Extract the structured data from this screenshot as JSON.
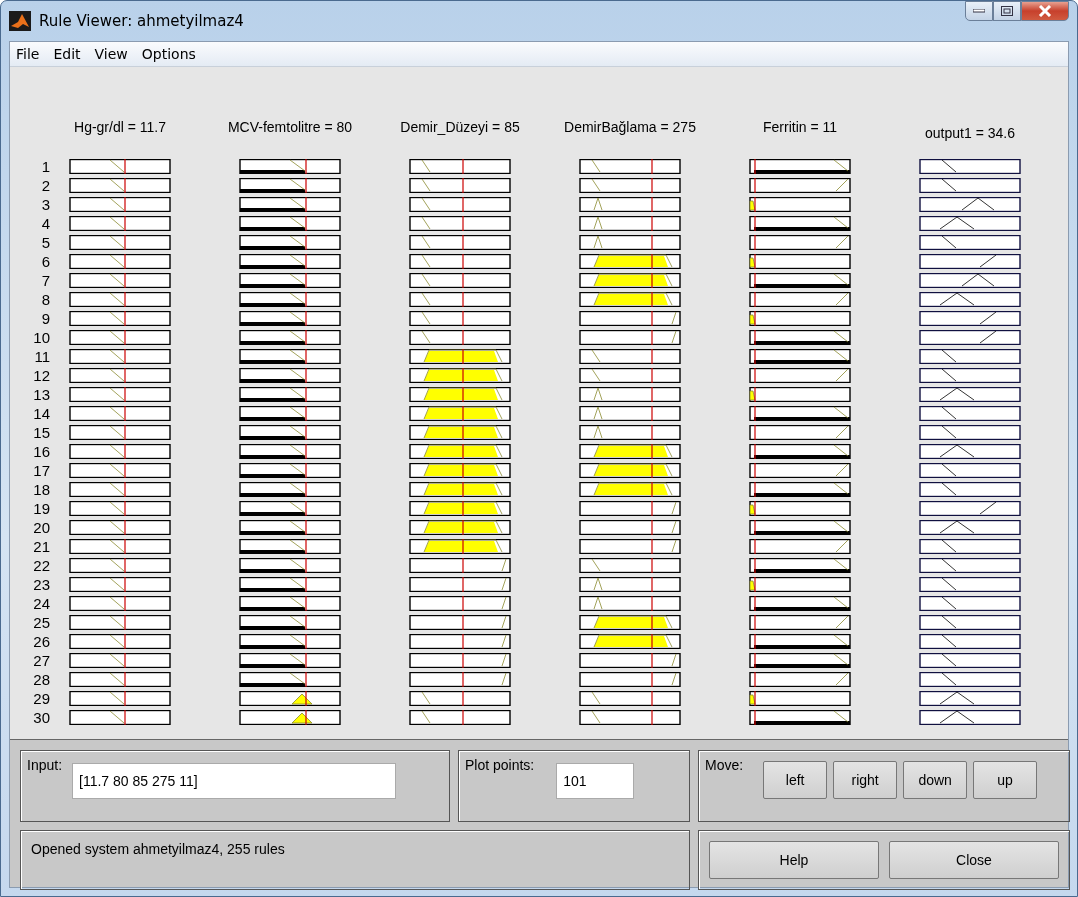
{
  "window": {
    "title": "Rule Viewer: ahmetyilmaz4"
  },
  "menu": [
    "File",
    "Edit",
    "View",
    "Options"
  ],
  "columns": [
    {
      "label": "Hg-gr/dl = 11.7"
    },
    {
      "label": "MCV-femtolitre = 80"
    },
    {
      "label": "Demir_Düzeyi = 85"
    },
    {
      "label": "DemirBağlama = 275"
    },
    {
      "label": "Ferritin = 11"
    },
    {
      "label": "output1 = 34.6"
    }
  ],
  "rules": [
    {
      "number": "1",
      "cells": [
        {
          "kind": "z-center"
        },
        {
          "kind": "z-right-fired"
        },
        {
          "kind": "z-left"
        },
        {
          "kind": "z-left"
        },
        {
          "kind": "z-far-fired"
        },
        {
          "kind": "out-low"
        }
      ]
    },
    {
      "number": "2",
      "cells": [
        {
          "kind": "z-center"
        },
        {
          "kind": "z-right-fired"
        },
        {
          "kind": "z-left"
        },
        {
          "kind": "z-left"
        },
        {
          "kind": "s-far"
        },
        {
          "kind": "out-low"
        }
      ]
    },
    {
      "number": "3",
      "cells": [
        {
          "kind": "z-center"
        },
        {
          "kind": "z-right-fired"
        },
        {
          "kind": "z-left"
        },
        {
          "kind": "tri-left"
        },
        {
          "kind": "left-fired"
        },
        {
          "kind": "out-tri-mid"
        }
      ]
    },
    {
      "number": "4",
      "cells": [
        {
          "kind": "z-center"
        },
        {
          "kind": "z-right-fired"
        },
        {
          "kind": "z-left"
        },
        {
          "kind": "tri-left"
        },
        {
          "kind": "z-far-fired"
        },
        {
          "kind": "out-tri-left"
        }
      ]
    },
    {
      "number": "5",
      "cells": [
        {
          "kind": "z-center"
        },
        {
          "kind": "z-right-fired"
        },
        {
          "kind": "z-left"
        },
        {
          "kind": "tri-left"
        },
        {
          "kind": "s-far"
        },
        {
          "kind": "out-low"
        }
      ]
    },
    {
      "number": "6",
      "cells": [
        {
          "kind": "z-center"
        },
        {
          "kind": "z-right-fired"
        },
        {
          "kind": "z-left"
        },
        {
          "kind": "trap-fired"
        },
        {
          "kind": "left-fired"
        },
        {
          "kind": "out-high"
        }
      ]
    },
    {
      "number": "7",
      "cells": [
        {
          "kind": "z-center"
        },
        {
          "kind": "z-right-fired"
        },
        {
          "kind": "z-left"
        },
        {
          "kind": "trap-fired"
        },
        {
          "kind": "z-far-fired"
        },
        {
          "kind": "out-tri-mid"
        }
      ]
    },
    {
      "number": "8",
      "cells": [
        {
          "kind": "z-center"
        },
        {
          "kind": "z-right-fired"
        },
        {
          "kind": "z-left"
        },
        {
          "kind": "trap-fired"
        },
        {
          "kind": "s-far"
        },
        {
          "kind": "out-tri-left"
        }
      ]
    },
    {
      "number": "9",
      "cells": [
        {
          "kind": "z-center"
        },
        {
          "kind": "z-right-fired"
        },
        {
          "kind": "z-left"
        },
        {
          "kind": "s-right"
        },
        {
          "kind": "left-fired"
        },
        {
          "kind": "out-high"
        }
      ]
    },
    {
      "number": "10",
      "cells": [
        {
          "kind": "z-center"
        },
        {
          "kind": "z-right-fired"
        },
        {
          "kind": "z-left"
        },
        {
          "kind": "s-right"
        },
        {
          "kind": "z-far-fired"
        },
        {
          "kind": "out-high"
        }
      ]
    },
    {
      "number": "11",
      "cells": [
        {
          "kind": "z-center"
        },
        {
          "kind": "z-right-fired"
        },
        {
          "kind": "trap-fired"
        },
        {
          "kind": "z-left"
        },
        {
          "kind": "z-far-fired"
        },
        {
          "kind": "out-low"
        }
      ]
    },
    {
      "number": "12",
      "cells": [
        {
          "kind": "z-center"
        },
        {
          "kind": "z-right-fired"
        },
        {
          "kind": "trap-fired"
        },
        {
          "kind": "z-left"
        },
        {
          "kind": "s-far"
        },
        {
          "kind": "out-low"
        }
      ]
    },
    {
      "number": "13",
      "cells": [
        {
          "kind": "z-center"
        },
        {
          "kind": "z-right-fired"
        },
        {
          "kind": "trap-fired"
        },
        {
          "kind": "tri-left"
        },
        {
          "kind": "left-fired"
        },
        {
          "kind": "out-tri-left"
        }
      ]
    },
    {
      "number": "14",
      "cells": [
        {
          "kind": "z-center"
        },
        {
          "kind": "z-right-fired"
        },
        {
          "kind": "trap-fired"
        },
        {
          "kind": "tri-left"
        },
        {
          "kind": "z-far-fired"
        },
        {
          "kind": "out-low"
        }
      ]
    },
    {
      "number": "15",
      "cells": [
        {
          "kind": "z-center"
        },
        {
          "kind": "z-right-fired"
        },
        {
          "kind": "trap-fired"
        },
        {
          "kind": "tri-left"
        },
        {
          "kind": "s-far"
        },
        {
          "kind": "out-low"
        }
      ]
    },
    {
      "number": "16",
      "cells": [
        {
          "kind": "z-center"
        },
        {
          "kind": "z-right-fired"
        },
        {
          "kind": "trap-fired"
        },
        {
          "kind": "trap-fired"
        },
        {
          "kind": "z-far-fired"
        },
        {
          "kind": "out-tri-left"
        }
      ]
    },
    {
      "number": "17",
      "cells": [
        {
          "kind": "z-center"
        },
        {
          "kind": "z-right-fired"
        },
        {
          "kind": "trap-fired"
        },
        {
          "kind": "trap-fired"
        },
        {
          "kind": "s-far"
        },
        {
          "kind": "out-low"
        }
      ]
    },
    {
      "number": "18",
      "cells": [
        {
          "kind": "z-center"
        },
        {
          "kind": "z-right-fired"
        },
        {
          "kind": "trap-fired"
        },
        {
          "kind": "trap-fired"
        },
        {
          "kind": "z-far-fired"
        },
        {
          "kind": "out-low"
        }
      ]
    },
    {
      "number": "19",
      "cells": [
        {
          "kind": "z-center"
        },
        {
          "kind": "z-right-fired"
        },
        {
          "kind": "trap-fired"
        },
        {
          "kind": "s-right"
        },
        {
          "kind": "left-fired"
        },
        {
          "kind": "out-high"
        }
      ]
    },
    {
      "number": "20",
      "cells": [
        {
          "kind": "z-center"
        },
        {
          "kind": "z-right-fired"
        },
        {
          "kind": "trap-fired"
        },
        {
          "kind": "s-right"
        },
        {
          "kind": "z-far-fired"
        },
        {
          "kind": "out-tri-left"
        }
      ]
    },
    {
      "number": "21",
      "cells": [
        {
          "kind": "z-center"
        },
        {
          "kind": "z-right-fired"
        },
        {
          "kind": "trap-fired"
        },
        {
          "kind": "s-right"
        },
        {
          "kind": "s-far"
        },
        {
          "kind": "out-low"
        }
      ]
    },
    {
      "number": "22",
      "cells": [
        {
          "kind": "z-center"
        },
        {
          "kind": "z-right-fired"
        },
        {
          "kind": "s-right"
        },
        {
          "kind": "z-left"
        },
        {
          "kind": "z-far-fired"
        },
        {
          "kind": "out-low"
        }
      ]
    },
    {
      "number": "23",
      "cells": [
        {
          "kind": "z-center"
        },
        {
          "kind": "z-right-fired"
        },
        {
          "kind": "s-right"
        },
        {
          "kind": "tri-left"
        },
        {
          "kind": "left-fired"
        },
        {
          "kind": "out-low"
        }
      ]
    },
    {
      "number": "24",
      "cells": [
        {
          "kind": "z-center"
        },
        {
          "kind": "z-right-fired"
        },
        {
          "kind": "s-right"
        },
        {
          "kind": "tri-left"
        },
        {
          "kind": "z-far-fired"
        },
        {
          "kind": "out-low"
        }
      ]
    },
    {
      "number": "25",
      "cells": [
        {
          "kind": "z-center"
        },
        {
          "kind": "z-right-fired"
        },
        {
          "kind": "s-right"
        },
        {
          "kind": "trap-fired"
        },
        {
          "kind": "s-far"
        },
        {
          "kind": "out-low"
        }
      ]
    },
    {
      "number": "26",
      "cells": [
        {
          "kind": "z-center"
        },
        {
          "kind": "z-right-fired"
        },
        {
          "kind": "s-right"
        },
        {
          "kind": "trap-fired"
        },
        {
          "kind": "z-far-fired"
        },
        {
          "kind": "out-low"
        }
      ]
    },
    {
      "number": "27",
      "cells": [
        {
          "kind": "z-center"
        },
        {
          "kind": "z-right-fired"
        },
        {
          "kind": "s-right"
        },
        {
          "kind": "s-right"
        },
        {
          "kind": "z-far-fired"
        },
        {
          "kind": "out-low"
        }
      ]
    },
    {
      "number": "28",
      "cells": [
        {
          "kind": "z-center"
        },
        {
          "kind": "z-right-fired"
        },
        {
          "kind": "s-right"
        },
        {
          "kind": "s-right"
        },
        {
          "kind": "s-far"
        },
        {
          "kind": "out-low"
        }
      ]
    },
    {
      "number": "29",
      "cells": [
        {
          "kind": "z-center"
        },
        {
          "kind": "tri-right-fired"
        },
        {
          "kind": "z-left"
        },
        {
          "kind": "z-left"
        },
        {
          "kind": "left-fired"
        },
        {
          "kind": "out-tri-left"
        }
      ]
    },
    {
      "number": "30",
      "cells": [
        {
          "kind": "z-center"
        },
        {
          "kind": "tri-right-fired"
        },
        {
          "kind": "z-left"
        },
        {
          "kind": "z-left"
        },
        {
          "kind": "z-far-fired"
        },
        {
          "kind": "out-tri-left"
        }
      ]
    }
  ],
  "input": {
    "label": "Input:",
    "value": "[11.7 80 85 275 11]"
  },
  "plot_points": {
    "label": "Plot points:",
    "value": "101"
  },
  "move": {
    "label": "Move:",
    "buttons": [
      "left",
      "right",
      "down",
      "up"
    ]
  },
  "status": "Opened system ahmetyilmaz4, 255 rules",
  "buttons": [
    "Help",
    "Close"
  ]
}
